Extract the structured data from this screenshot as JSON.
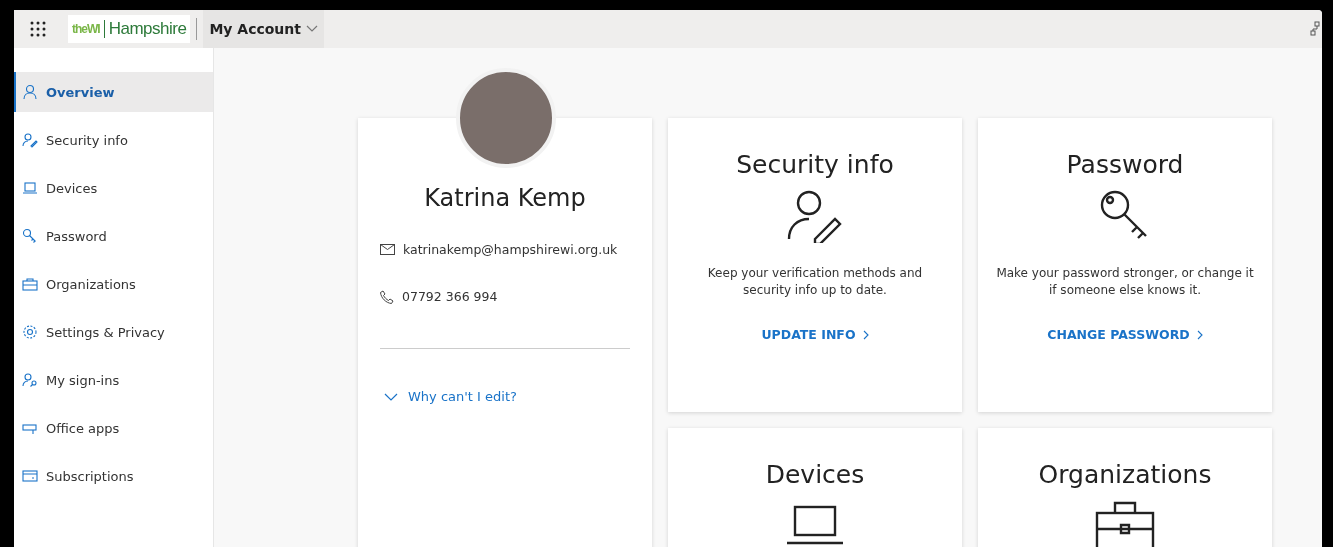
{
  "header": {
    "logo_mark": "theWI",
    "logo_text": "Hampshire",
    "app_title": "My Account"
  },
  "sidebar": {
    "items": [
      {
        "label": "Overview",
        "selected": true
      },
      {
        "label": "Security info",
        "selected": false
      },
      {
        "label": "Devices",
        "selected": false
      },
      {
        "label": "Password",
        "selected": false
      },
      {
        "label": "Organizations",
        "selected": false
      },
      {
        "label": "Settings & Privacy",
        "selected": false
      },
      {
        "label": "My sign-ins",
        "selected": false
      },
      {
        "label": "Office apps",
        "selected": false
      },
      {
        "label": "Subscriptions",
        "selected": false
      }
    ]
  },
  "profile": {
    "name": "Katrina Kemp",
    "email": "katrinakemp@hampshirewi.org.uk",
    "phone": "07792 366 994",
    "edit_link": "Why can't I edit?"
  },
  "tiles": [
    {
      "title": "Security info",
      "description": "Keep your verification methods and security info up to date.",
      "link": "UPDATE INFO"
    },
    {
      "title": "Password",
      "description": "Make your password stronger, or change it if someone else knows it.",
      "link": "CHANGE PASSWORD"
    },
    {
      "title": "Devices"
    },
    {
      "title": "Organizations"
    }
  ]
}
